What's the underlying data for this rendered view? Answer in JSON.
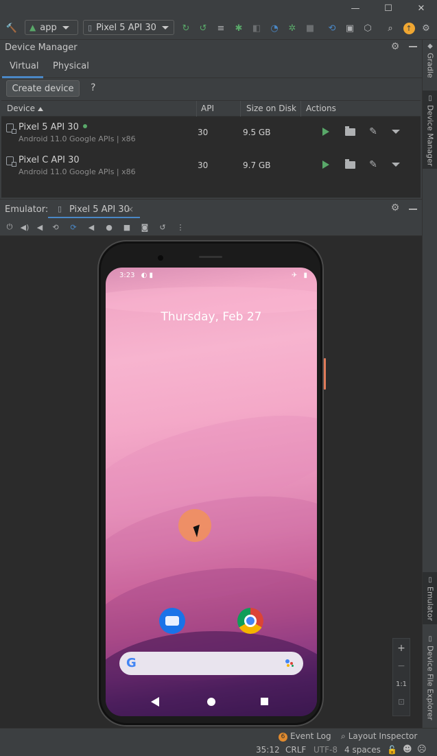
{
  "window": {
    "minimize_icon": "—",
    "maximize_icon": "☐",
    "close_icon": "✕"
  },
  "toolbar": {
    "run_config": "app",
    "device_selector": "Pixel 5 API 30",
    "update_badge_color": "#f0a732"
  },
  "right_strip": {
    "tabs": [
      "Gradle",
      "Device Manager",
      "Emulator",
      "Device File Explorer"
    ]
  },
  "device_manager": {
    "title": "Device Manager",
    "tabs": [
      "Virtual",
      "Physical"
    ],
    "create_button": "Create device",
    "help": "?",
    "columns": [
      "Device",
      "API",
      "Size on Disk",
      "Actions"
    ],
    "devices": [
      {
        "name": "Pixel 5 API 30",
        "subtitle": "Android 11.0 Google APIs | x86",
        "api": "30",
        "size": "9.5 GB",
        "online": true
      },
      {
        "name": "Pixel C API 30",
        "subtitle": "Android 11.0 Google APIs | x86",
        "api": "30",
        "size": "9.7 GB",
        "online": false
      }
    ]
  },
  "emulator": {
    "label": "Emulator:",
    "tab_label": "Pixel 5 API 30",
    "tab_close": "×",
    "screen": {
      "time": "3:23",
      "date": "Thursday, Feb 27",
      "google_letter": "G"
    },
    "zoom": {
      "plus": "+",
      "minus": "−",
      "one_to_one": "1:1"
    }
  },
  "status_bar": {
    "event_count": "6",
    "event_log": "Event Log",
    "layout_inspector": "Layout Inspector",
    "position": "35:12",
    "line_sep": "CRLF",
    "encoding": "UTF-8",
    "indent": "4 spaces"
  },
  "colors": {
    "accent": "#4a88c7",
    "play_green": "#59a869",
    "touch_orange": "#f09060"
  }
}
